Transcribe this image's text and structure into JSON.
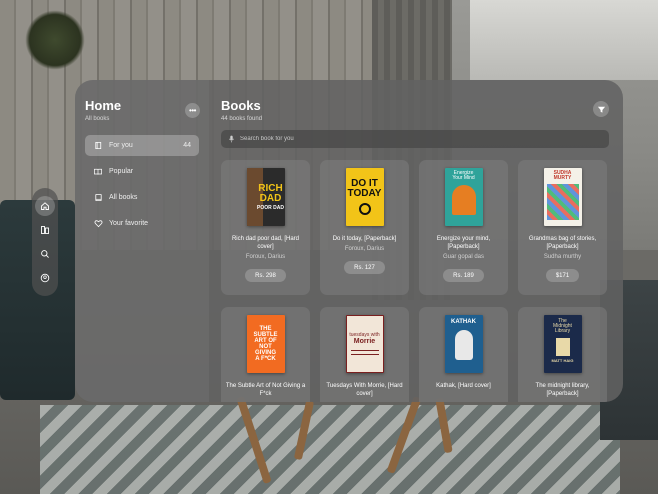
{
  "sidebar": {
    "title": "Home",
    "subtitle": "All books",
    "items": [
      {
        "label": "For you",
        "count": "44",
        "icon": "book-open-icon",
        "active": true
      },
      {
        "label": "Popular",
        "count": "",
        "icon": "open-book-icon",
        "active": false
      },
      {
        "label": "All books",
        "count": "",
        "icon": "book-icon",
        "active": false
      },
      {
        "label": "Your favorite",
        "count": "",
        "icon": "heart-icon",
        "active": false
      }
    ]
  },
  "main": {
    "title": "Books",
    "subtitle": "44 books found",
    "search_placeholder": "Search book for you"
  },
  "books": [
    {
      "title": "Rich dad poor dad, [Hard cover]",
      "author": "Foroux, Darius",
      "price": "Rs. 298",
      "cover": {
        "bg": "#2b2b2b",
        "accent": "#f2c418",
        "text": "RICH DAD",
        "sub": "POOR DAD"
      }
    },
    {
      "title": "Do it today, [Paperback]",
      "author": "Foroux, Darius",
      "price": "Rs. 127",
      "cover": {
        "bg": "#f2c418",
        "accent": "#111111",
        "text": "DO IT TODAY",
        "sub": ""
      }
    },
    {
      "title": "Energize your mind, [Paperback]",
      "author": "Guar gopal das",
      "price": "Rs. 189",
      "cover": {
        "bg": "#2fa39a",
        "accent": "#ffffff",
        "text": "Energize Your Mind",
        "sub": ""
      }
    },
    {
      "title": "Grandmas bag of stories, [Paperback]",
      "author": "Sudha murthy",
      "price": "$171",
      "cover": {
        "bg": "#f4f1e8",
        "accent": "#c0392b",
        "text": "SUDHA MURTY",
        "sub": ""
      }
    },
    {
      "title": "The Subtle Art of Not Giving a F*ck",
      "author": "",
      "price": "",
      "cover": {
        "bg": "#f26b21",
        "accent": "#ffffff",
        "text": "THE SUBTLE ART OF NOT GIVING A F*CK",
        "sub": ""
      }
    },
    {
      "title": "Tuesdays With Morrie, [Hard cover]",
      "author": "",
      "price": "",
      "cover": {
        "bg": "#f2e6d8",
        "accent": "#7a1f1f",
        "text": "tuesdays with Morrie",
        "sub": ""
      }
    },
    {
      "title": "Kathak, [Hard cover]",
      "author": "",
      "price": "",
      "cover": {
        "bg": "#1f5f8f",
        "accent": "#ffffff",
        "text": "KATHAK",
        "sub": ""
      }
    },
    {
      "title": "The midnight library, [Paperback]",
      "author": "",
      "price": "",
      "cover": {
        "bg": "#1b2a4a",
        "accent": "#e8d9a8",
        "text": "The Midnight Library",
        "sub": "MATT HAIG"
      }
    }
  ]
}
